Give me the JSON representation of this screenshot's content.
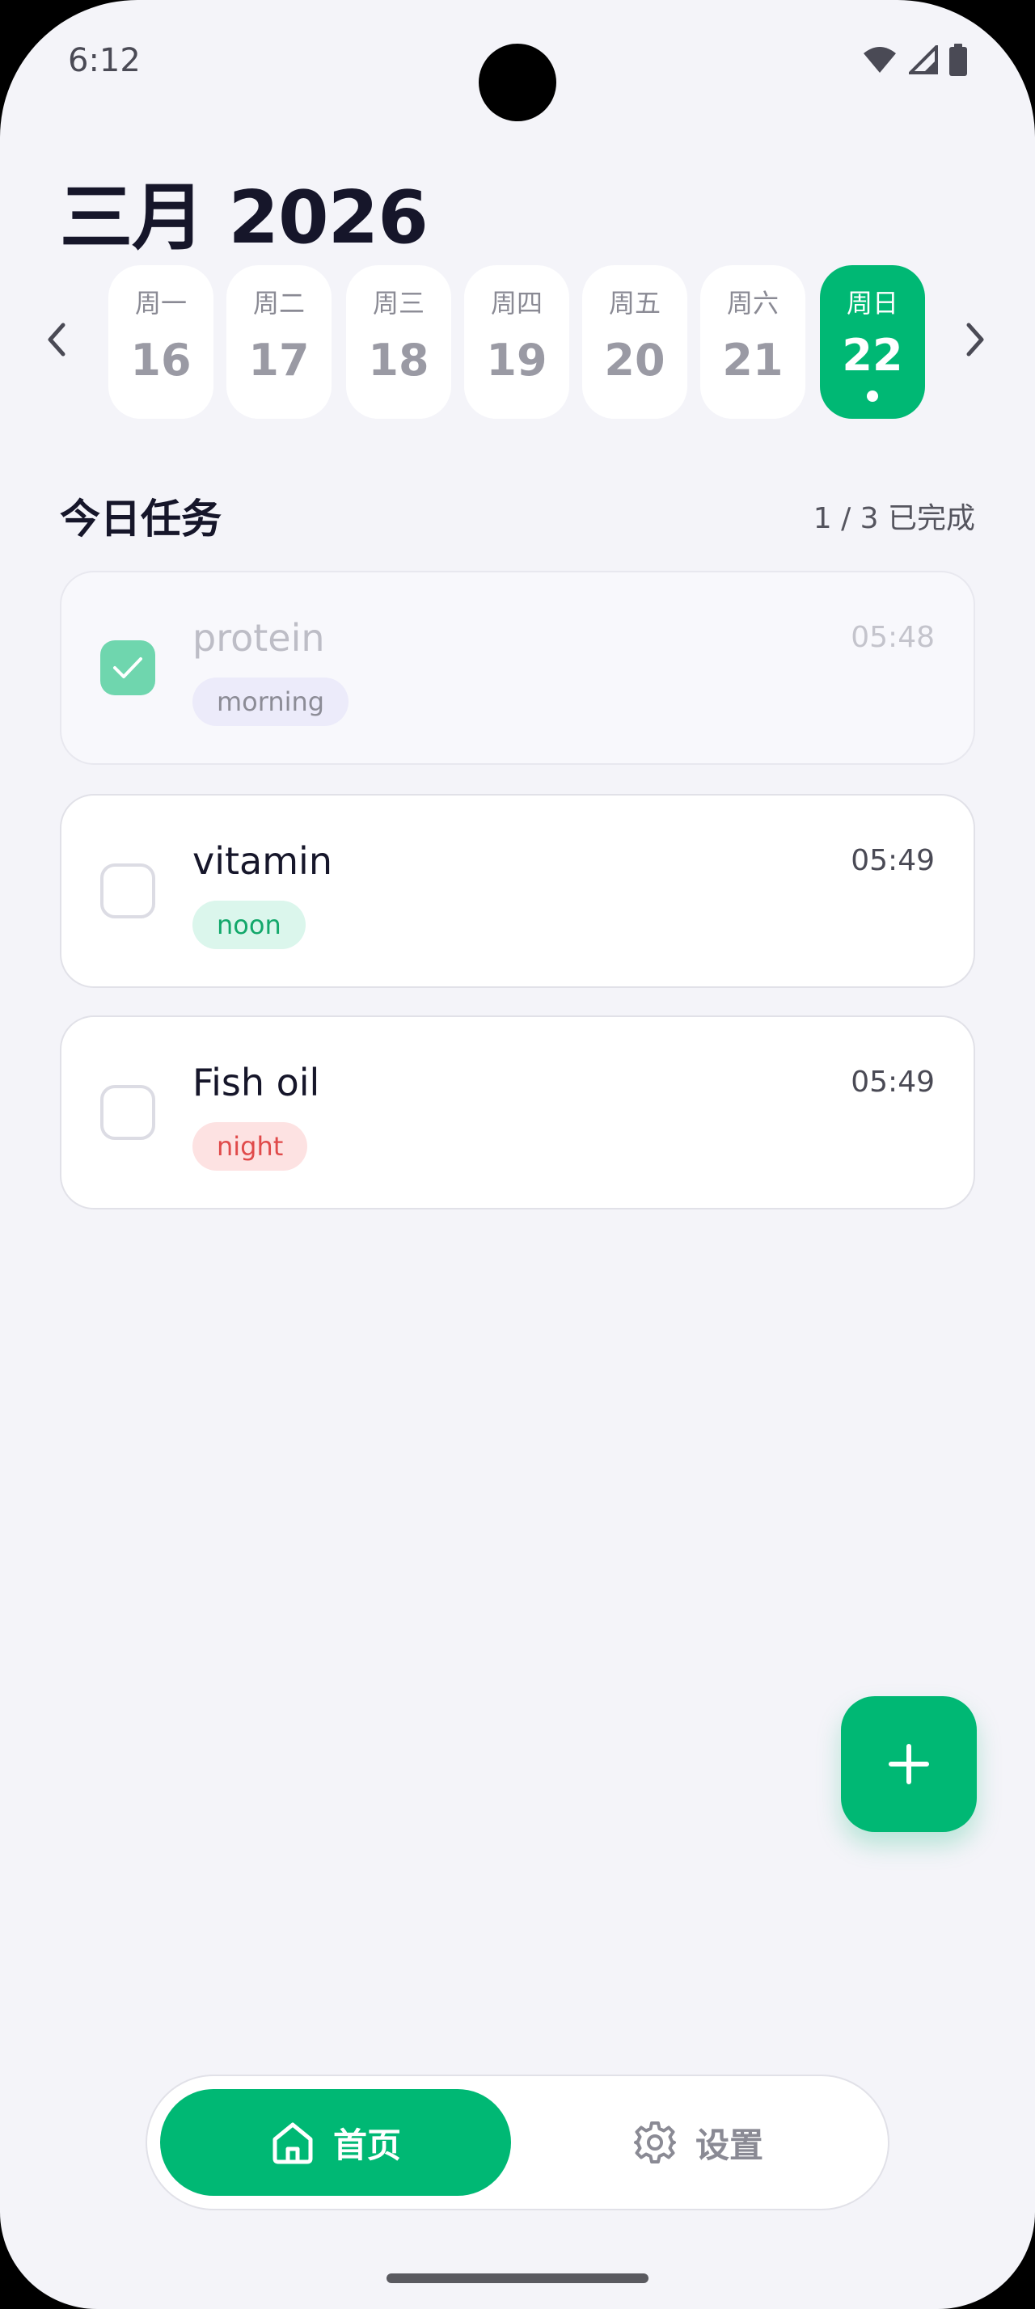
{
  "status_bar": {
    "time": "6:12"
  },
  "header": {
    "month_title": "三月 2026"
  },
  "week": {
    "days": [
      {
        "weekday": "周一",
        "date": "16"
      },
      {
        "weekday": "周二",
        "date": "17"
      },
      {
        "weekday": "周三",
        "date": "18"
      },
      {
        "weekday": "周四",
        "date": "19"
      },
      {
        "weekday": "周五",
        "date": "20"
      },
      {
        "weekday": "周六",
        "date": "21"
      },
      {
        "weekday": "周日",
        "date": "22",
        "selected": true
      }
    ]
  },
  "tasks_section": {
    "title": "今日任务",
    "progress": "1 / 3 已完成",
    "items": [
      {
        "name": "protein",
        "time": "05:48",
        "tag": "morning",
        "done": true
      },
      {
        "name": "vitamin",
        "time": "05:49",
        "tag": "noon",
        "done": false
      },
      {
        "name": "Fish oil",
        "time": "05:49",
        "tag": "night",
        "done": false
      }
    ]
  },
  "fab": {
    "icon": "plus-icon"
  },
  "bottom_nav": {
    "home_label": "首页",
    "settings_label": "设置"
  },
  "colors": {
    "accent": "#00b874",
    "background": "#f4f4f9",
    "checked": "#6fd6ae"
  }
}
